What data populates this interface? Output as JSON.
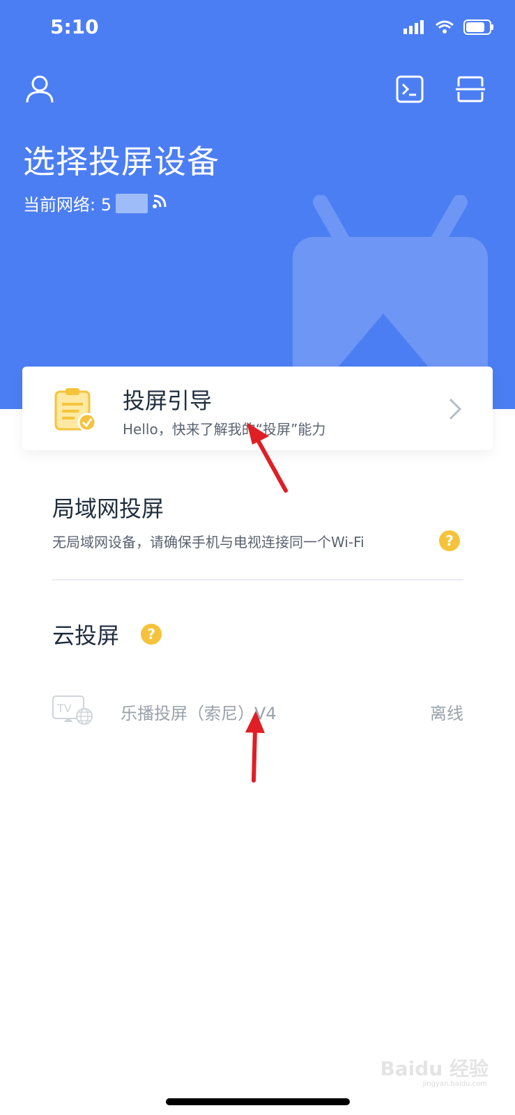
{
  "status_bar": {
    "time": "5:10"
  },
  "header": {
    "title": "选择投屏设备",
    "network_label": "当前网络: 5"
  },
  "guide": {
    "title": "投屏引导",
    "subtitle": "Hello，快来了解我的“投屏”能力"
  },
  "lan": {
    "title": "局域网投屏",
    "description": "无局域网设备，请确保手机与电视连接同一个Wi-Fi"
  },
  "cloud": {
    "title": "云投屏",
    "device": {
      "name": "乐播投屏（索尼）V4",
      "status": "离线"
    }
  },
  "watermark": {
    "text": "Baidu 经验",
    "sub": "jingyan.baidu.com"
  },
  "colors": {
    "header_bg": "#4c7ef3",
    "help_icon": "#f5c33b",
    "arrow": "#e01e25"
  }
}
